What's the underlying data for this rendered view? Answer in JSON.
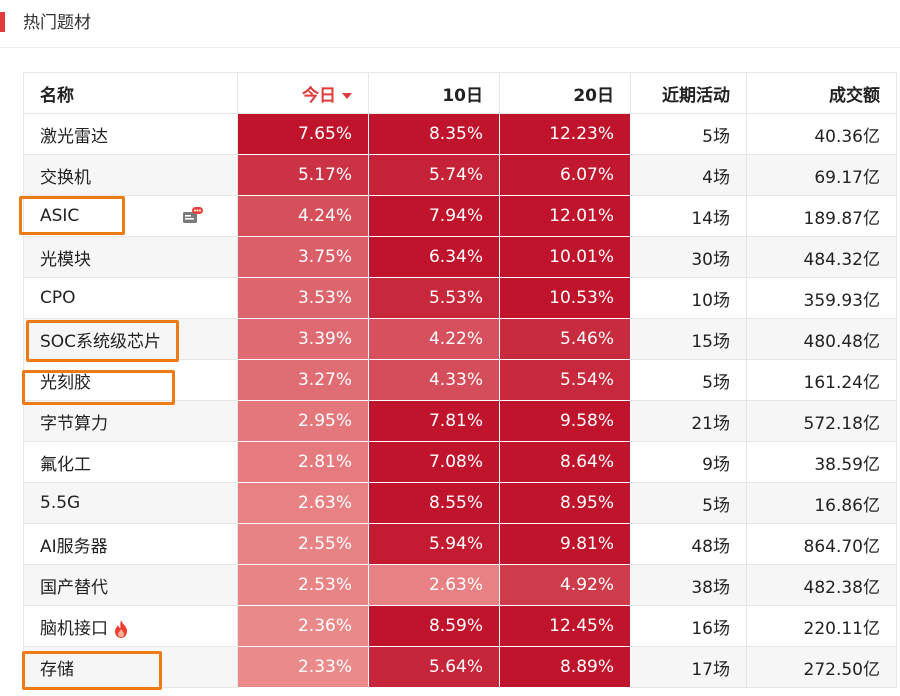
{
  "header": {
    "title": "热门题材",
    "accent": "#e03a3a"
  },
  "table": {
    "columns": {
      "name": "名称",
      "today": "今日",
      "d10": "10日",
      "d20": "20日",
      "activity": "近期活动",
      "turnover": "成交额"
    },
    "rows": [
      {
        "name": "激光雷达",
        "today": "7.65%",
        "d10": "8.35%",
        "d20": "12.23%",
        "activity": "5场",
        "turnover": "40.36亿"
      },
      {
        "name": "交换机",
        "today": "5.17%",
        "d10": "5.74%",
        "d20": "6.07%",
        "activity": "4场",
        "turnover": "69.17亿"
      },
      {
        "name": "ASIC",
        "today": "4.24%",
        "d10": "7.94%",
        "d20": "12.01%",
        "activity": "14场",
        "turnover": "189.87亿",
        "icon": "news-icon"
      },
      {
        "name": "光模块",
        "today": "3.75%",
        "d10": "6.34%",
        "d20": "10.01%",
        "activity": "30场",
        "turnover": "484.32亿"
      },
      {
        "name": "CPO",
        "today": "3.53%",
        "d10": "5.53%",
        "d20": "10.53%",
        "activity": "10场",
        "turnover": "359.93亿"
      },
      {
        "name": "SOC系统级芯片",
        "today": "3.39%",
        "d10": "4.22%",
        "d20": "5.46%",
        "activity": "15场",
        "turnover": "480.48亿"
      },
      {
        "name": "光刻胶",
        "today": "3.27%",
        "d10": "4.33%",
        "d20": "5.54%",
        "activity": "5场",
        "turnover": "161.24亿"
      },
      {
        "name": "字节算力",
        "today": "2.95%",
        "d10": "7.81%",
        "d20": "9.58%",
        "activity": "21场",
        "turnover": "572.18亿"
      },
      {
        "name": "氟化工",
        "today": "2.81%",
        "d10": "7.08%",
        "d20": "8.64%",
        "activity": "9场",
        "turnover": "38.59亿"
      },
      {
        "name": "5.5G",
        "today": "2.63%",
        "d10": "8.55%",
        "d20": "8.95%",
        "activity": "5场",
        "turnover": "16.86亿"
      },
      {
        "name": "AI服务器",
        "today": "2.55%",
        "d10": "5.94%",
        "d20": "9.81%",
        "activity": "48场",
        "turnover": "864.70亿"
      },
      {
        "name": "国产替代",
        "today": "2.53%",
        "d10": "2.63%",
        "d20": "4.92%",
        "activity": "38场",
        "turnover": "482.38亿"
      },
      {
        "name": "脑机接口",
        "today": "2.36%",
        "d10": "8.59%",
        "d20": "12.45%",
        "activity": "16场",
        "turnover": "220.11亿",
        "icon": "fire-icon"
      },
      {
        "name": "存储",
        "today": "2.33%",
        "d10": "5.64%",
        "d20": "8.89%",
        "activity": "17场",
        "turnover": "272.50亿"
      }
    ],
    "highlighted_rows": [
      "ASIC",
      "SOC系统级芯片",
      "光刻胶",
      "存储"
    ]
  },
  "colors": {
    "heat_max": "#c0142c",
    "heat_min": "#ec8e8e",
    "highlight_border": "#ee7a14",
    "sort_active": "#e03a3a"
  }
}
